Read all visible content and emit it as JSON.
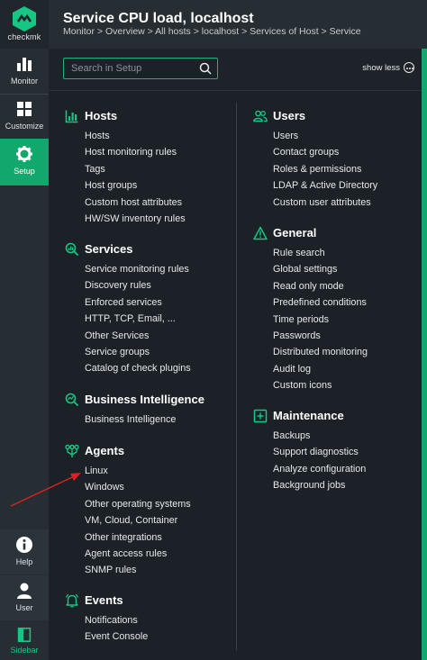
{
  "brand": {
    "name": "checkmk",
    "accent": "#13a86b"
  },
  "nav": {
    "monitor": "Monitor",
    "customize": "Customize",
    "setup": "Setup",
    "help": "Help",
    "user": "User",
    "sidebar": "Sidebar"
  },
  "header": {
    "title": "Service CPU load, localhost",
    "breadcrumb": "Monitor > Overview > All hosts > localhost > Services of Host > Service"
  },
  "search": {
    "placeholder": "Search in Setup",
    "show_less": "show less"
  },
  "left_sections": [
    {
      "title": "Hosts",
      "icon": "hosts-icon",
      "items": [
        "Hosts",
        "Host monitoring rules",
        "Tags",
        "Host groups",
        "Custom host attributes",
        "HW/SW inventory rules"
      ]
    },
    {
      "title": "Services",
      "icon": "services-icon",
      "items": [
        "Service monitoring rules",
        "Discovery rules",
        "Enforced services",
        "HTTP, TCP, Email, ...",
        "Other Services",
        "Service groups",
        "Catalog of check plugins"
      ]
    },
    {
      "title": "Business Intelligence",
      "icon": "bi-icon",
      "items": [
        "Business Intelligence"
      ]
    },
    {
      "title": "Agents",
      "icon": "agents-icon",
      "items": [
        "Linux",
        "Windows",
        "Other operating systems",
        "VM, Cloud, Container",
        "Other integrations",
        "Agent access rules",
        "SNMP rules"
      ]
    },
    {
      "title": "Events",
      "icon": "events-icon",
      "items": [
        "Notifications",
        "Event Console"
      ]
    }
  ],
  "right_sections": [
    {
      "title": "Users",
      "icon": "users-icon",
      "items": [
        "Users",
        "Contact groups",
        "Roles & permissions",
        "LDAP & Active Directory",
        "Custom user attributes"
      ]
    },
    {
      "title": "General",
      "icon": "general-icon",
      "items": [
        "Rule search",
        "Global settings",
        "Read only mode",
        "Predefined conditions",
        "Time periods",
        "Passwords",
        "Distributed monitoring",
        "Audit log",
        "Custom icons"
      ]
    },
    {
      "title": "Maintenance",
      "icon": "maintenance-icon",
      "items": [
        "Backups",
        "Support diagnostics",
        "Analyze configuration",
        "Background jobs"
      ]
    }
  ]
}
